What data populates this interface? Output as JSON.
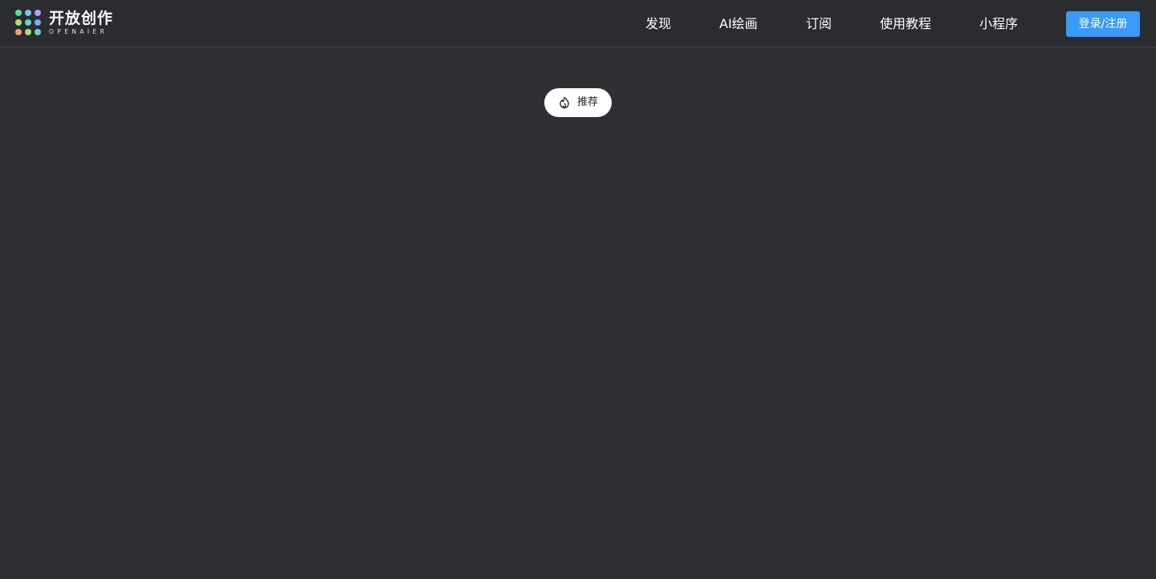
{
  "brand": {
    "name": "开放创作",
    "subtitle": "OPENAIER",
    "dot_colors": [
      "#5ad9a8",
      "#6fc4e8",
      "#b79cf0",
      "#a3e07a",
      "#62d2d8",
      "#7aa9f5",
      "#f7a072",
      "#a3e07a",
      "#5ad9c8"
    ],
    "logo_icon": "dot-grid-logo-icon"
  },
  "nav": {
    "items": [
      {
        "label": "发现"
      },
      {
        "label": "AI绘画"
      },
      {
        "label": "订阅"
      },
      {
        "label": "使用教程"
      },
      {
        "label": "小程序"
      }
    ],
    "login_label": "登录/注册"
  },
  "tabs": {
    "recommend_label": "推荐",
    "recommend_icon": "flame-icon"
  },
  "colors": {
    "background": "#2e2f33",
    "header": "#2b2c30",
    "accent": "#3a9af7"
  }
}
